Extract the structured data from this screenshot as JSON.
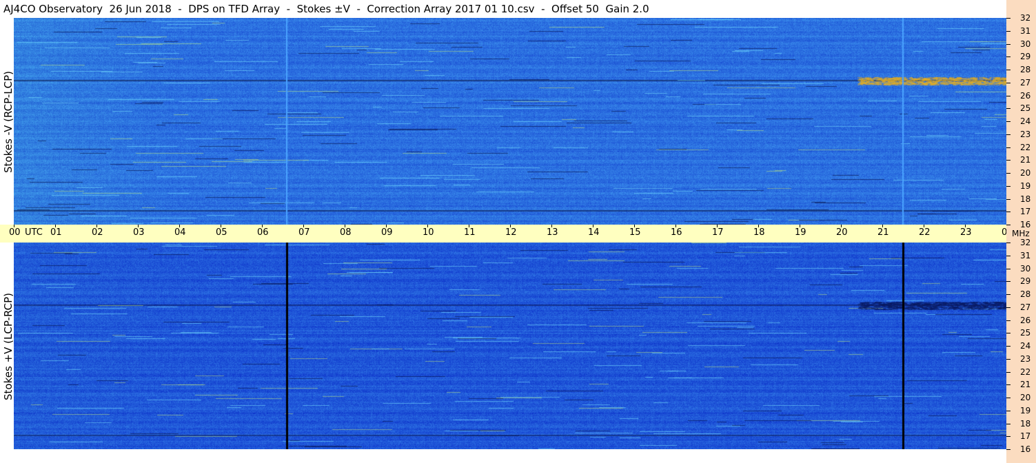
{
  "title": "AJ4CO Observatory  26 Jun 2018  -  DPS on TFD Array  -  Stokes ±V  -  Correction Array 2017 01 10.csv  -  Offset 50  Gain 2.0",
  "chart_data": {
    "type": "heatmap",
    "title": "AJ4CO Observatory  26 Jun 2018  -  DPS on TFD Array  -  Stokes ±V  -  Correction Array 2017 01 10.csv  -  Offset 50  Gain 2.0",
    "x_axis": {
      "unit_label": "UTC",
      "ticks": [
        "00",
        "01",
        "02",
        "03",
        "04",
        "05",
        "06",
        "07",
        "08",
        "09",
        "10",
        "11",
        "12",
        "13",
        "14",
        "15",
        "16",
        "17",
        "18",
        "19",
        "20",
        "21",
        "22",
        "23",
        "00"
      ],
      "range_hours": [
        0,
        24
      ]
    },
    "y_axis": {
      "unit_label": "MHz",
      "ticks": [
        "32",
        "31",
        "30",
        "29",
        "28",
        "27",
        "26",
        "25",
        "24",
        "23",
        "22",
        "21",
        "20",
        "19",
        "18",
        "17",
        "16"
      ],
      "range_mhz": [
        16,
        32
      ]
    },
    "panels": [
      {
        "name": "top",
        "ylabel": "Stokes -V (RCP-LCP)",
        "base_color": "#2b6fe0",
        "vertical_lines_utc": [
          6.58,
          21.48
        ],
        "vertical_line_color": "#4aa3ff",
        "burst_region": {
          "utc": [
            20.4,
            24.0
          ],
          "mhz": [
            26.8,
            27.4
          ],
          "color": "#e8b020"
        },
        "dark_bands_mhz": [
          17.1,
          27.2
        ]
      },
      {
        "name": "bottom",
        "ylabel": "Stokes +V (LCP-RCP)",
        "base_color": "#1f56d8",
        "vertical_lines_utc": [
          6.58,
          21.48
        ],
        "vertical_line_color": "#000000",
        "burst_region": {
          "utc": [
            20.4,
            24.0
          ],
          "mhz": [
            26.8,
            27.4
          ],
          "color": "#0a1a60"
        },
        "dark_bands_mhz": [
          17.1,
          27.2
        ]
      }
    ]
  }
}
